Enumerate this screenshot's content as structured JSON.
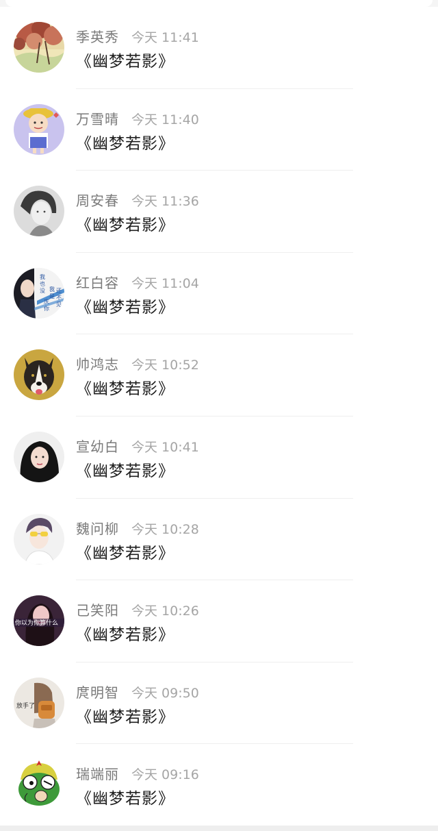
{
  "conversations": [
    {
      "name": "季英秀",
      "time": "今天 11:41",
      "message": "《幽梦若影》",
      "avatar": "blossom-tree-avatar"
    },
    {
      "name": "万雪晴",
      "time": "今天 11:40",
      "message": "《幽梦若影》",
      "avatar": "cartoon-boy-avatar"
    },
    {
      "name": "周安春",
      "time": "今天 11:36",
      "message": "《幽梦若影》",
      "avatar": "grayscale-portrait-avatar"
    },
    {
      "name": "红白容",
      "time": "今天 11:04",
      "message": "《幽梦若影》",
      "avatar": "girl-blue-text-avatar",
      "avatar_text": [
        "我",
        "也",
        "没",
        "我",
        "是",
        "还",
        "不",
        "见",
        "庆",
        "你"
      ]
    },
    {
      "name": "帅鸿志",
      "time": "今天 10:52",
      "message": "《幽梦若影》",
      "avatar": "dog-avatar"
    },
    {
      "name": "宣幼白",
      "time": "今天 10:41",
      "message": "《幽梦若影》",
      "avatar": "dark-hair-girl-avatar"
    },
    {
      "name": "魏问柳",
      "time": "今天 10:28",
      "message": "《幽梦若影》",
      "avatar": "yellow-glasses-avatar"
    },
    {
      "name": "己笑阳",
      "time": "今天 10:26",
      "message": "《幽梦若影》",
      "avatar": "dark-girl-text-avatar",
      "avatar_text": "你以为你算什么"
    },
    {
      "name": "庹明智",
      "time": "今天 09:50",
      "message": "《幽梦若影》",
      "avatar": "backpack-girl-avatar",
      "avatar_text": "放手了"
    },
    {
      "name": "瑞端丽",
      "time": "今天 09:16",
      "message": "《幽梦若影》",
      "avatar": "keroro-frog-avatar"
    }
  ]
}
